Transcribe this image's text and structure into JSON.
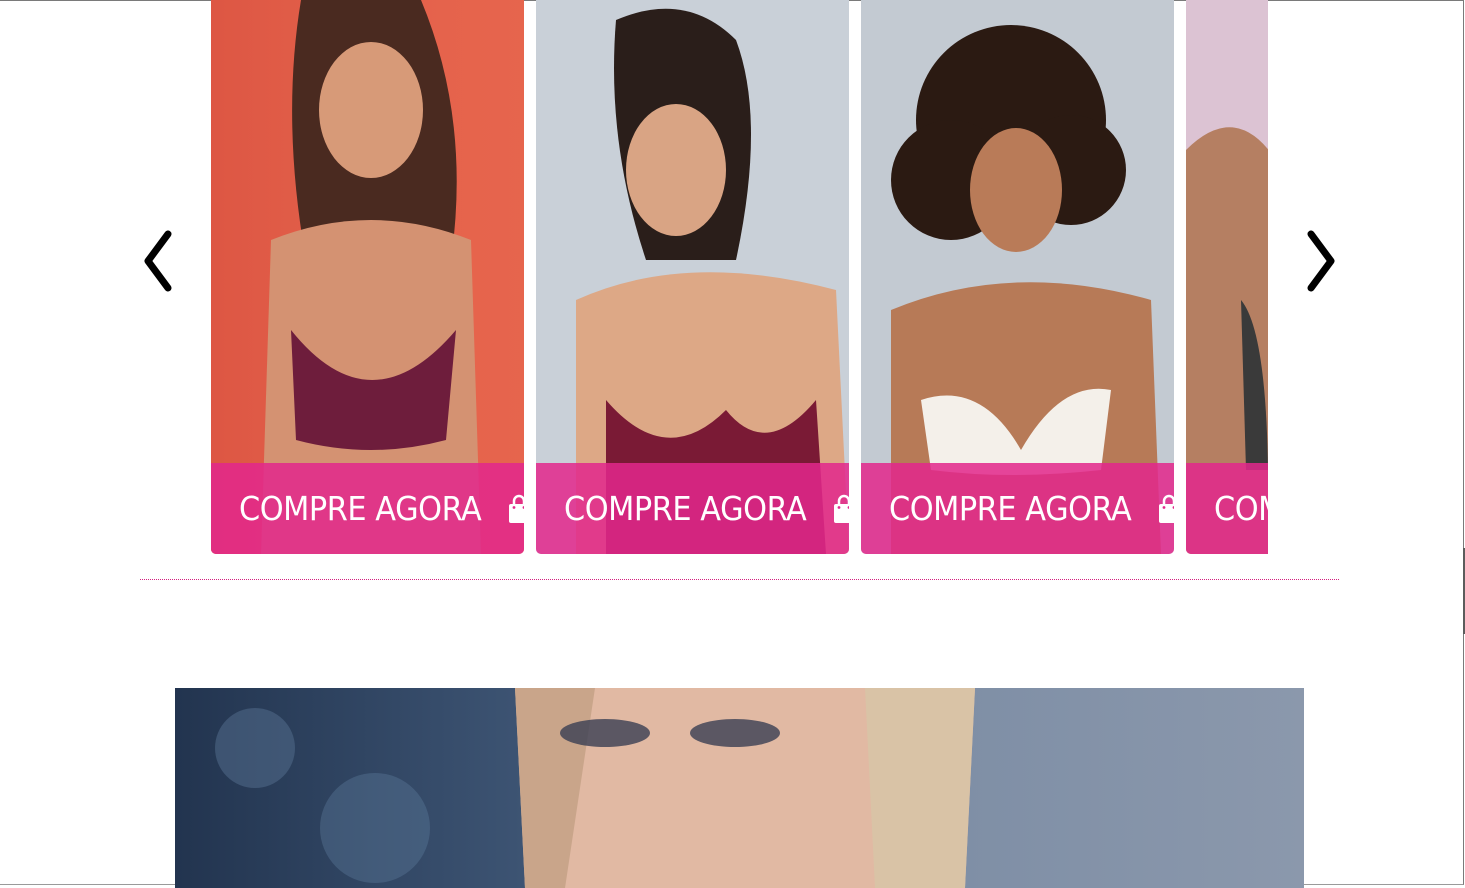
{
  "carousel": {
    "cards": [
      {
        "cta_label": "COMPRE AGORA",
        "photo_bg": "#e4604c",
        "garment": "#6e1d3c"
      },
      {
        "cta_label": "COMPRE AGORA",
        "photo_bg": "#c9d0d8",
        "garment": "#7a1a35"
      },
      {
        "cta_label": "COMPRE AGORA",
        "photo_bg": "#c3cad2",
        "garment": "#f4f0ea"
      },
      {
        "cta_label": "COMPRE AGORA",
        "photo_bg": "#dcc3d3",
        "garment": "#3a3a3a"
      }
    ],
    "icons": {
      "prev": "chevron-left-icon",
      "next": "chevron-right-icon",
      "cta": "shopping-bag-icon"
    }
  },
  "colors": {
    "accent": "#e2288c",
    "divider": "#d4217f"
  }
}
